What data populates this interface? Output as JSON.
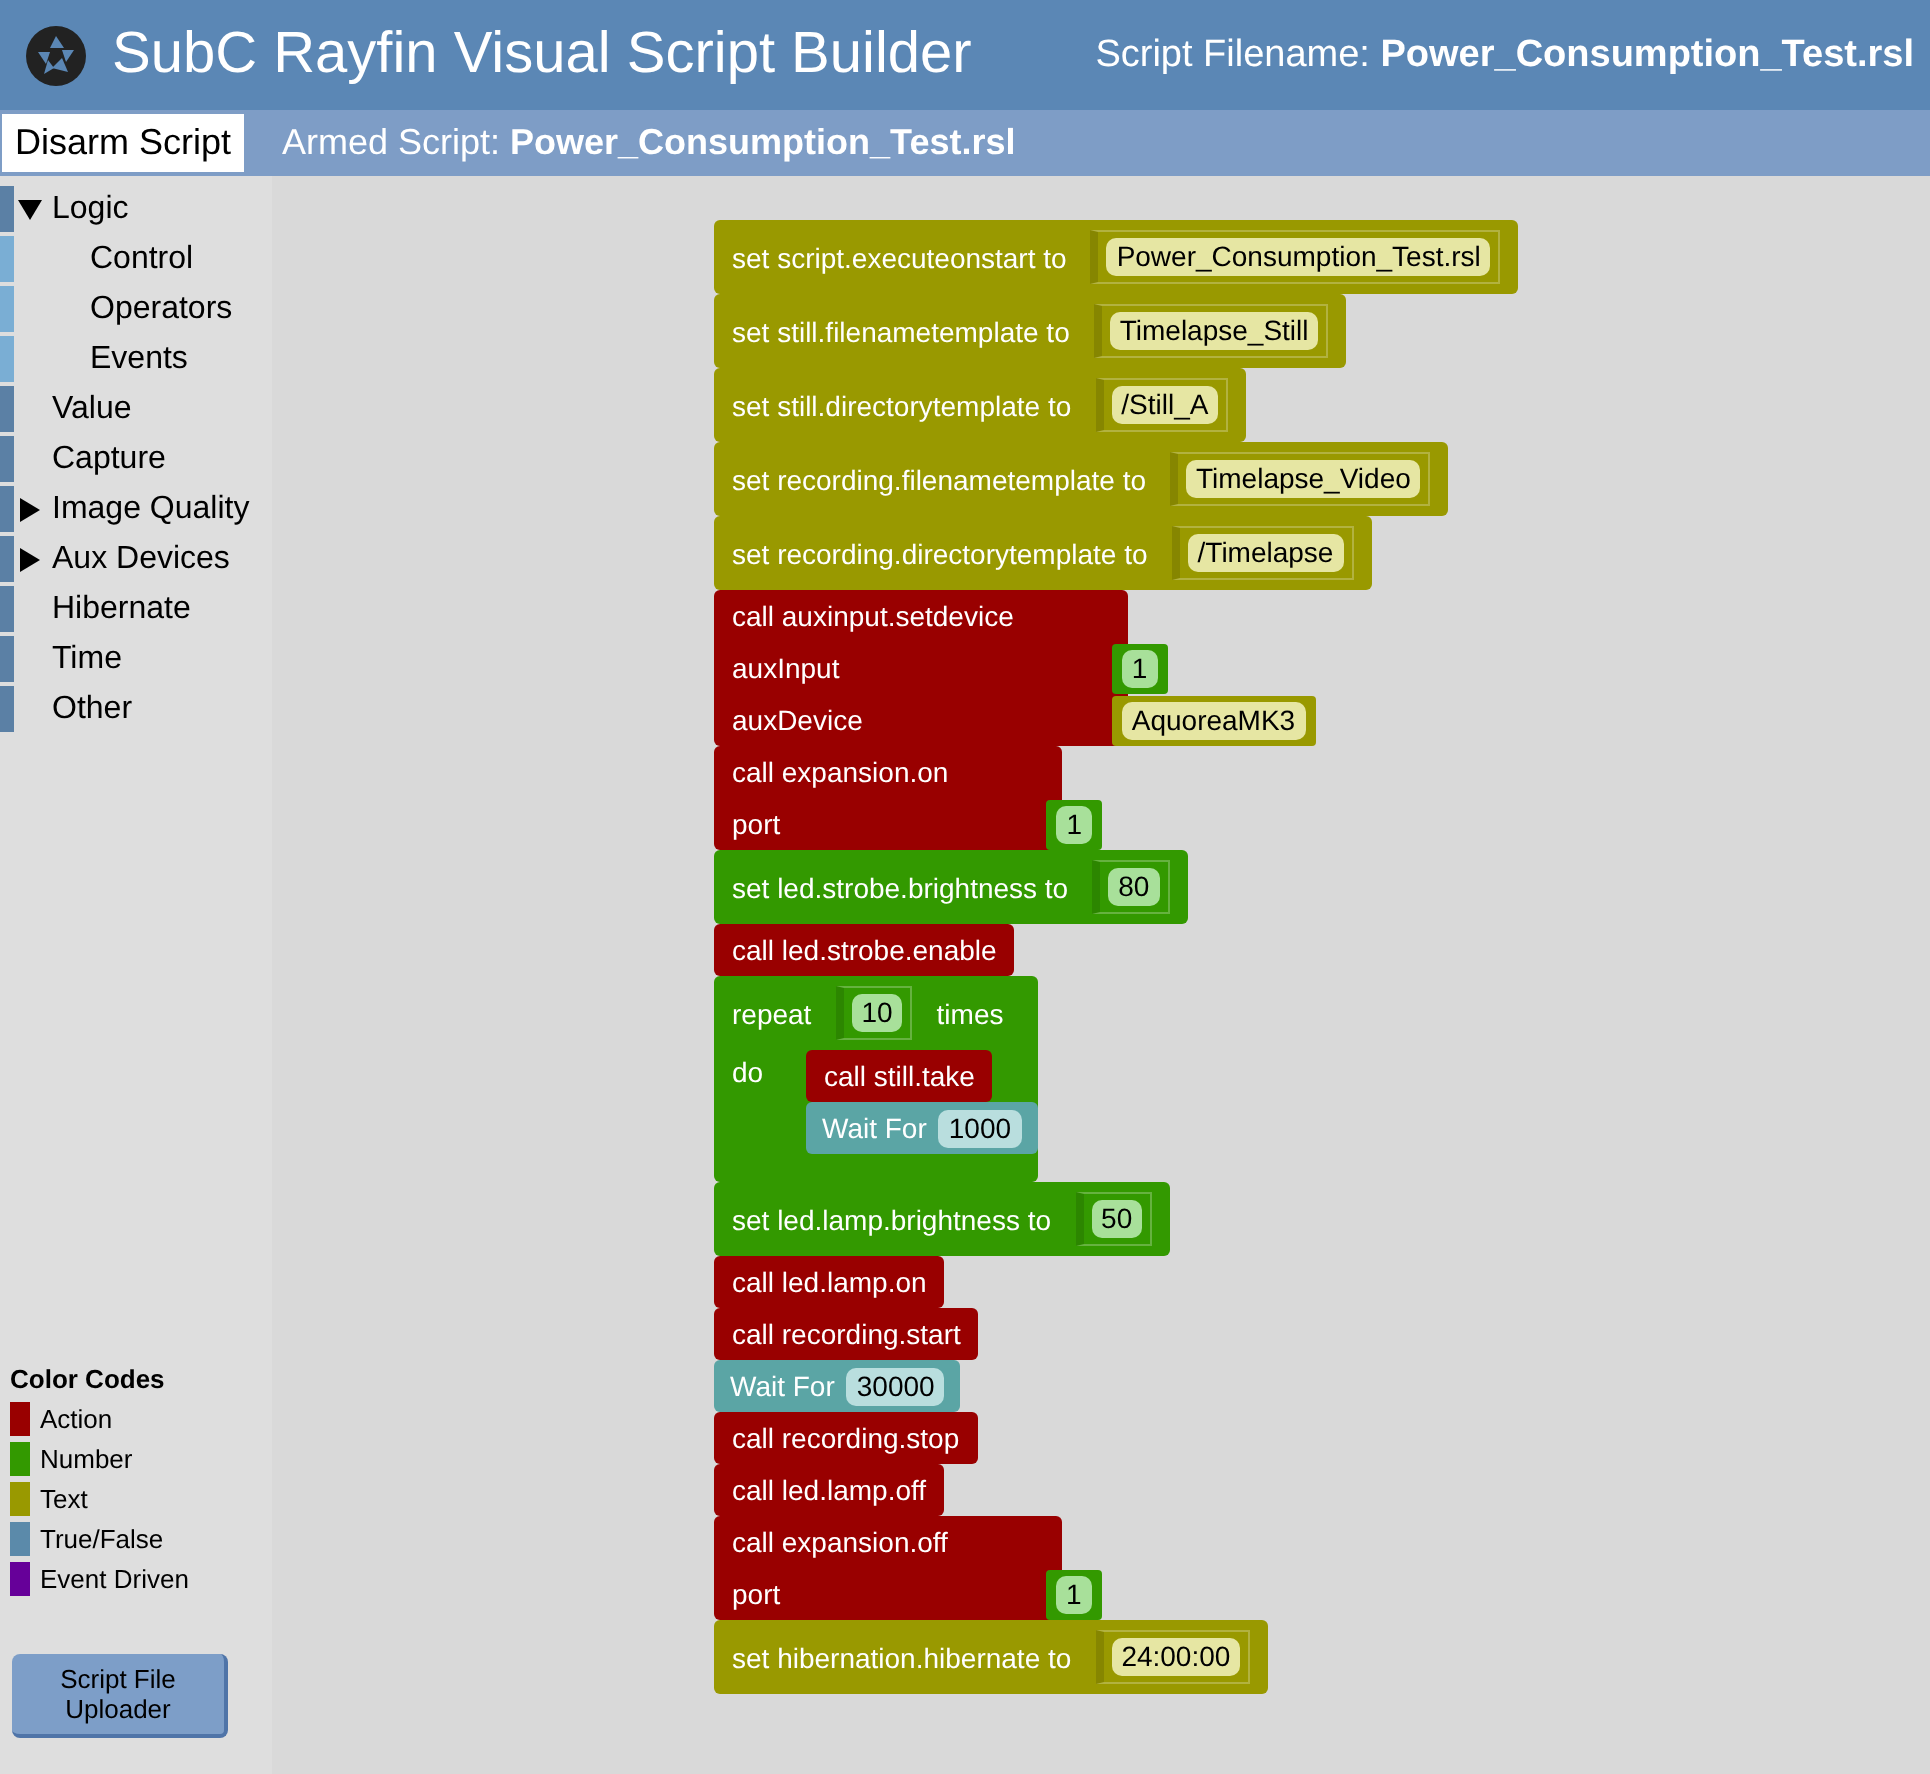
{
  "header": {
    "title": "SubC Rayfin Visual Script Builder",
    "filename_label": "Script Filename:",
    "filename": "Power_Consumption_Test.rsl"
  },
  "subbar": {
    "button": "Disarm Script",
    "armed_label": "Armed Script:",
    "armed": "Power_Consumption_Test.rsl"
  },
  "sidebar": {
    "items": [
      {
        "label": "Logic",
        "expanded": true,
        "children": [
          {
            "label": "Control"
          },
          {
            "label": "Operators"
          },
          {
            "label": "Events"
          }
        ]
      },
      {
        "label": "Value"
      },
      {
        "label": "Capture"
      },
      {
        "label": "Image Quality",
        "expanded": false
      },
      {
        "label": "Aux Devices",
        "expanded": false
      },
      {
        "label": "Hibernate"
      },
      {
        "label": "Time"
      },
      {
        "label": "Other"
      }
    ]
  },
  "legend": {
    "title": "Color Codes",
    "items": [
      {
        "label": "Action",
        "color": "#990000"
      },
      {
        "label": "Number",
        "color": "#339900"
      },
      {
        "label": "Text",
        "color": "#999900"
      },
      {
        "label": "True/False",
        "color": "#5b8aaa"
      },
      {
        "label": "Event Driven",
        "color": "#660099"
      }
    ]
  },
  "uploader_button": "Script File Uploader",
  "blocks": [
    {
      "kind": "set",
      "color": "#999900",
      "label": "set script.executeonstart to",
      "value": {
        "kind": "text",
        "text": "Power_Consumption_Test.rsl"
      }
    },
    {
      "kind": "set",
      "color": "#999900",
      "label": "set still.filenametemplate to",
      "value": {
        "kind": "text",
        "text": "Timelapse_Still"
      }
    },
    {
      "kind": "set",
      "color": "#999900",
      "label": "set still.directorytemplate to",
      "value": {
        "kind": "text",
        "text": "/Still_A"
      }
    },
    {
      "kind": "set",
      "color": "#999900",
      "label": "set recording.filenametemplate to",
      "value": {
        "kind": "text",
        "text": "Timelapse_Video"
      }
    },
    {
      "kind": "set",
      "color": "#999900",
      "label": "set recording.directorytemplate to",
      "value": {
        "kind": "text",
        "text": "/Timelapse"
      }
    },
    {
      "kind": "call",
      "color": "#990000",
      "label": "call auxinput.setdevice",
      "params": [
        {
          "label": "auxInput",
          "value": {
            "kind": "number",
            "text": "1"
          }
        },
        {
          "label": "auxDevice",
          "value": {
            "kind": "text",
            "text": "AquoreaMK3"
          }
        }
      ]
    },
    {
      "kind": "call",
      "color": "#990000",
      "label": "call expansion.on",
      "params": [
        {
          "label": "port",
          "value": {
            "kind": "number",
            "text": "1"
          }
        }
      ]
    },
    {
      "kind": "set",
      "color": "#339900",
      "label": "set led.strobe.brightness to",
      "value": {
        "kind": "number",
        "text": "80"
      }
    },
    {
      "kind": "call",
      "color": "#990000",
      "label": "call led.strobe.enable"
    },
    {
      "kind": "repeat",
      "color": "#339900",
      "label": "repeat",
      "value": {
        "kind": "number",
        "text": "10"
      },
      "suffix": "times",
      "do_label": "do",
      "children": [
        {
          "kind": "call",
          "color": "#990000",
          "label": "call still.take"
        },
        {
          "kind": "wait",
          "color": "#5ba5a5",
          "label": "Wait For",
          "value": {
            "kind": "wait",
            "text": "1000"
          }
        }
      ]
    },
    {
      "kind": "set",
      "color": "#339900",
      "label": "set led.lamp.brightness to",
      "value": {
        "kind": "number",
        "text": "50"
      }
    },
    {
      "kind": "call",
      "color": "#990000",
      "label": "call led.lamp.on"
    },
    {
      "kind": "call",
      "color": "#990000",
      "label": "call recording.start"
    },
    {
      "kind": "wait",
      "color": "#5ba5a5",
      "label": "Wait For",
      "value": {
        "kind": "wait",
        "text": "30000"
      }
    },
    {
      "kind": "call",
      "color": "#990000",
      "label": "call recording.stop"
    },
    {
      "kind": "call",
      "color": "#990000",
      "label": "call led.lamp.off"
    },
    {
      "kind": "call",
      "color": "#990000",
      "label": "call expansion.off",
      "params": [
        {
          "label": "port",
          "value": {
            "kind": "number",
            "text": "1"
          }
        }
      ]
    },
    {
      "kind": "set",
      "color": "#999900",
      "label": "set hibernation.hibernate to",
      "value": {
        "kind": "text",
        "text": "24:00:00"
      }
    }
  ]
}
